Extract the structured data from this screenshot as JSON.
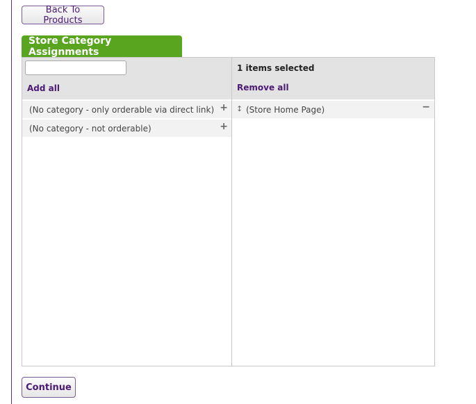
{
  "back_button": {
    "label": "Back To Products"
  },
  "section": {
    "title": "Store Category Assignments"
  },
  "available": {
    "search": {
      "value": "",
      "placeholder": ""
    },
    "add_all_label": "Add all",
    "items": [
      {
        "label": "(No category - only orderable via direct link)",
        "action_icon": "+"
      },
      {
        "label": "(No category - not orderable)",
        "action_icon": "+"
      }
    ]
  },
  "selected": {
    "count_label": "1 items selected",
    "remove_all_label": "Remove all",
    "items": [
      {
        "label": "(Store Home Page)",
        "drag_icon": "↕",
        "action_icon": "−"
      }
    ]
  },
  "continue_button": {
    "label": "Continue"
  },
  "colors": {
    "accent_green": "#5aa51f",
    "link_purple": "#4b1a75",
    "header_gray": "#e3e3e3"
  },
  "icons": {
    "add": "plus-icon",
    "remove": "minus-icon",
    "reorder": "drag-handle-icon"
  }
}
